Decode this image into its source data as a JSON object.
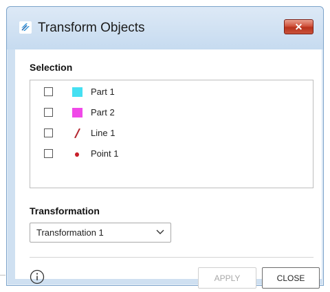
{
  "window": {
    "title": "Transform Objects",
    "close_glyph": "✕"
  },
  "selection": {
    "label": "Selection",
    "items": [
      {
        "label": "Part 1",
        "icon": "cyan-square-icon",
        "color": "#45e0f2",
        "checked": false
      },
      {
        "label": "Part 2",
        "icon": "magenta-square-icon",
        "color": "#f049e8",
        "checked": false
      },
      {
        "label": "Line 1",
        "icon": "line-icon",
        "color": "#b32630",
        "checked": false
      },
      {
        "label": "Point 1",
        "icon": "point-icon",
        "color": "#c8202a",
        "checked": false
      }
    ]
  },
  "transformation": {
    "label": "Transformation",
    "selected": "Transformation 1"
  },
  "footer": {
    "apply_label": "APPLY",
    "close_label": "CLOSE",
    "apply_enabled": false
  },
  "colors": {
    "titlebar": "#c6dbf0",
    "close_button": "#c9533b",
    "border": "#7aa2c9"
  }
}
